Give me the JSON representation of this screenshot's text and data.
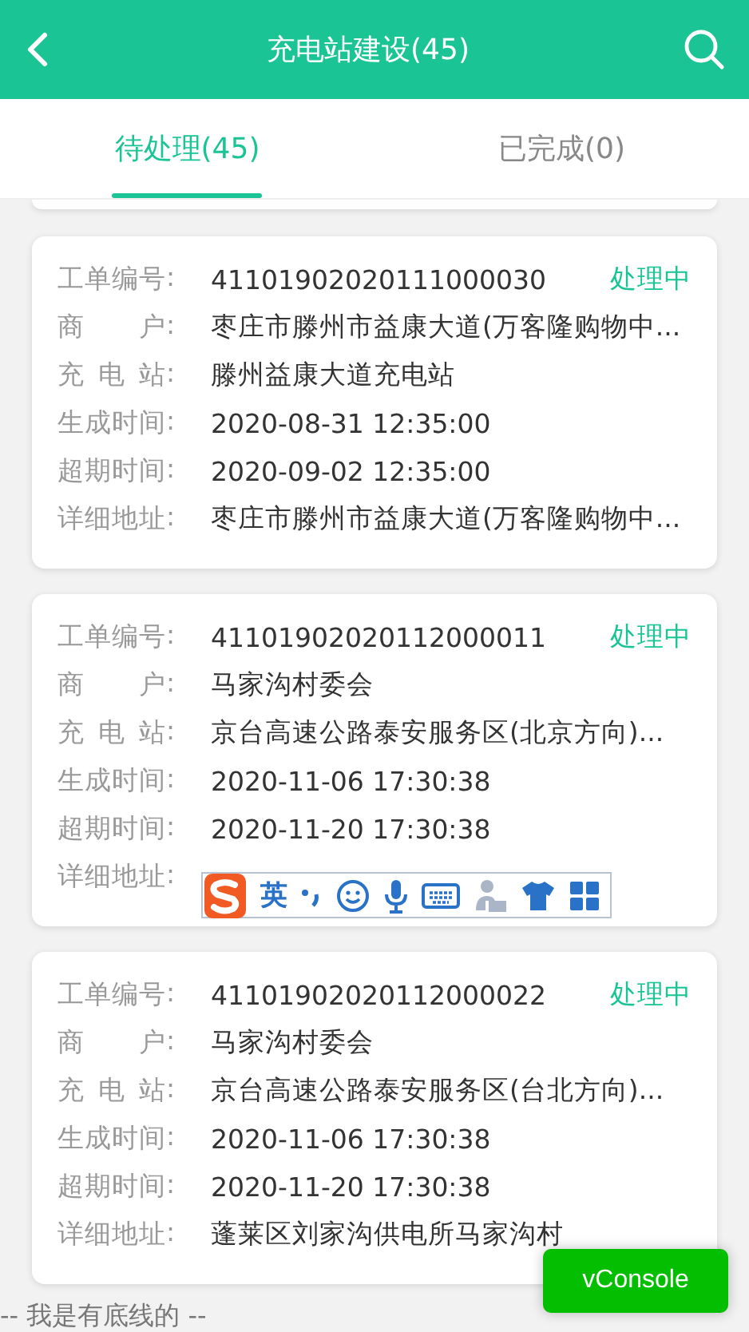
{
  "header": {
    "title": "充电站建设(45)"
  },
  "tabs": [
    {
      "label": "待处理(45)",
      "selected": true
    },
    {
      "label": "已完成(0)",
      "selected": false
    }
  ],
  "orders": [
    {
      "status": "处理中",
      "fields": [
        {
          "label": "工单编号:",
          "value": "41101902020111000030"
        },
        {
          "label": "商户:",
          "value": "枣庄市滕州市益康大道(万客隆购物中..."
        },
        {
          "label": "充电站:",
          "value": "滕州益康大道充电站"
        },
        {
          "label": "生成时间:",
          "value": "2020-08-31 12:35:00"
        },
        {
          "label": "超期时间:",
          "value": "2020-09-02 12:35:00"
        },
        {
          "label": "详细地址:",
          "value": "枣庄市滕州市益康大道(万客隆购物中..."
        }
      ]
    },
    {
      "status": "处理中",
      "ime": {
        "language": "英"
      },
      "fields": [
        {
          "label": "工单编号:",
          "value": "41101902020112000011"
        },
        {
          "label": "商户:",
          "value": "马家沟村委会"
        },
        {
          "label": "充电站:",
          "value": "京台高速公路泰安服务区(北京方向)..."
        },
        {
          "label": "生成时间:",
          "value": "2020-11-06 17:30:38"
        },
        {
          "label": "超期时间:",
          "value": "2020-11-20 17:30:38"
        },
        {
          "label": "详细地址:"
        }
      ]
    },
    {
      "status": "处理中",
      "fields": [
        {
          "label": "工单编号:",
          "value": "41101902020112000022"
        },
        {
          "label": "商户:",
          "value": "马家沟村委会"
        },
        {
          "label": "充电站:",
          "value": "京台高速公路泰安服务区(台北方向)..."
        },
        {
          "label": "生成时间:",
          "value": "2020-11-06 17:30:38"
        },
        {
          "label": "超期时间:",
          "value": "2020-11-20 17:30:38"
        },
        {
          "label": "详细地址:",
          "value": "蓬莱区刘家沟供电所马家沟村"
        }
      ]
    }
  ],
  "footer": "-- 我是有底线的 --",
  "vconsole_button": "vConsole"
}
